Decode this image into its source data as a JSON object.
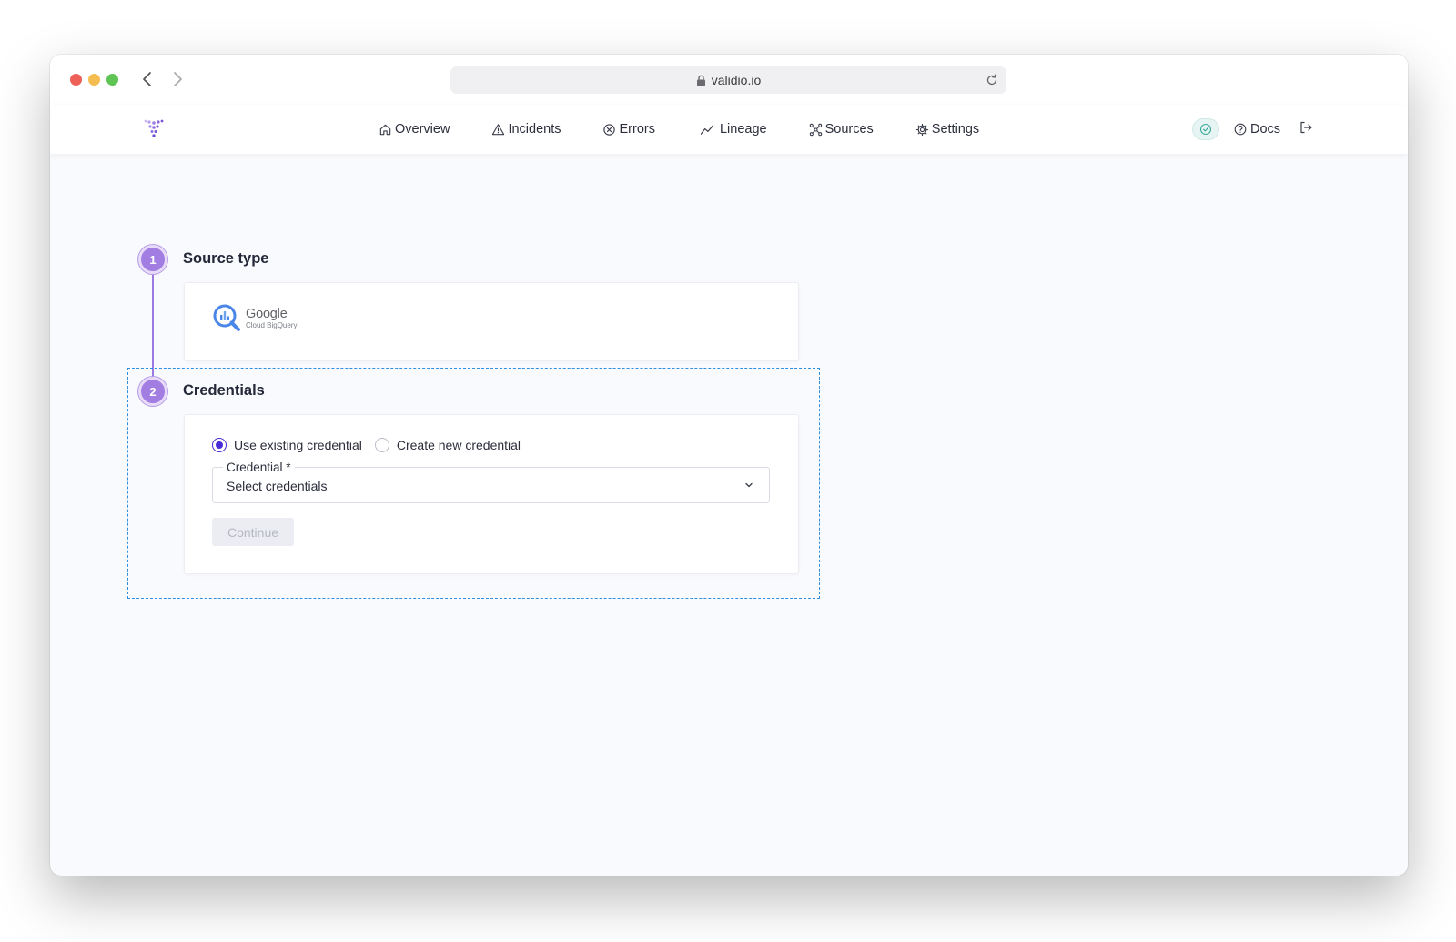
{
  "browser": {
    "url": "validio.io",
    "icons": {
      "back": "chevron-left-icon",
      "forward": "chevron-right-icon",
      "lock": "lock-icon",
      "reload": "reload-icon"
    },
    "traffic_light_colors": {
      "close": "#ee5f57",
      "minimize": "#f5bd4f",
      "maximize": "#5ec453"
    }
  },
  "header": {
    "logo": "validio-logo",
    "nav": [
      {
        "label": "Overview",
        "icon": "home-icon"
      },
      {
        "label": "Incidents",
        "icon": "warning-icon"
      },
      {
        "label": "Errors",
        "icon": "error-circle-icon"
      },
      {
        "label": "Lineage",
        "icon": "trend-line-icon"
      },
      {
        "label": "Sources",
        "icon": "network-icon"
      },
      {
        "label": "Settings",
        "icon": "gear-icon"
      }
    ],
    "status_icon": "check-circle-icon",
    "docs_label": "Docs",
    "docs_icon": "help-circle-icon",
    "logout_icon": "logout-icon"
  },
  "steps": [
    {
      "number": "1",
      "title": "Source type",
      "source": {
        "brand": "Google",
        "product": "Cloud BigQuery",
        "icon": "bigquery-icon"
      }
    },
    {
      "number": "2",
      "title": "Credentials",
      "radio_options": [
        {
          "label": "Use existing credential",
          "selected": true
        },
        {
          "label": "Create new credential",
          "selected": false
        }
      ],
      "credential_field": {
        "label": "Credential *",
        "value": "Select credentials",
        "icon": "chevron-down-icon"
      },
      "continue_label": "Continue",
      "continue_disabled": true
    }
  ],
  "colors": {
    "accent": "#4a2bd6",
    "step_circle": "#a37ee2",
    "focus_outline": "#2f8ee0"
  }
}
